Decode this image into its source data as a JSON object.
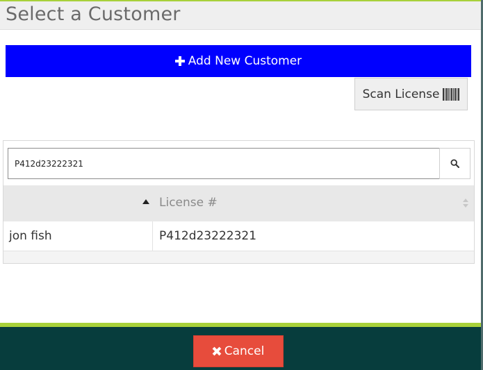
{
  "modal": {
    "title": "Select a Customer"
  },
  "actions": {
    "add_label": "Add New Customer",
    "add_icon": "plus-icon",
    "scan_label": "Scan License",
    "scan_icon": "barcode-icon"
  },
  "search": {
    "value": "P412d23222321",
    "icon": "search-icon"
  },
  "table": {
    "columns": [
      "",
      "License #"
    ],
    "sorted_column": 0,
    "sort_direction": "ascending",
    "rows": [
      {
        "name": "jon fish",
        "license": "P412d23222321"
      }
    ]
  },
  "footer": {
    "cancel_label": "Cancel",
    "cancel_icon": "times-icon"
  },
  "colors": {
    "primary_button": "#0000ff",
    "cancel_button": "#e74c3c",
    "accent_green": "#a8d13a",
    "footer_bg": "#073d3d"
  }
}
